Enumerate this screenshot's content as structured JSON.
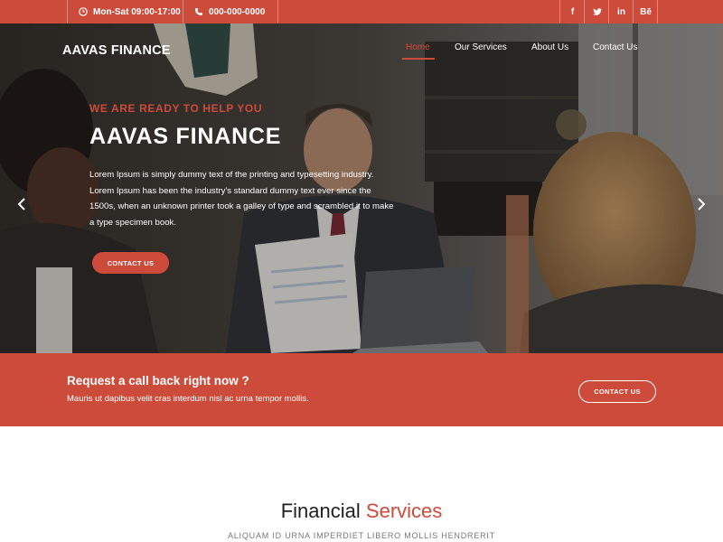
{
  "colors": {
    "accent": "#cd4b3a",
    "text_dark": "#1e1e1e",
    "muted": "#777777"
  },
  "topbar": {
    "hours": {
      "icon": "clock-icon",
      "text": "Mon-Sat 09:00-17:00"
    },
    "phone": {
      "icon": "phone-icon",
      "text": "000-000-0000"
    },
    "social": [
      {
        "name": "facebook-icon",
        "glyph": "f"
      },
      {
        "name": "twitter-icon",
        "glyph": "t"
      },
      {
        "name": "linkedin-icon",
        "glyph": "in"
      },
      {
        "name": "behance-icon",
        "glyph": "Bē"
      }
    ]
  },
  "header": {
    "brand": "AAVAS FINANCE",
    "nav": [
      {
        "label": "Home",
        "active": true
      },
      {
        "label": "Our Services",
        "active": false
      },
      {
        "label": "About Us",
        "active": false
      },
      {
        "label": "Contact Us",
        "active": false
      }
    ]
  },
  "hero": {
    "kicker": "WE ARE READY TO HELP YOU",
    "title": "AAVAS FINANCE",
    "description": "Lorem Ipsum is simply dummy text of the printing and typesetting industry. Lorem Ipsum has been the industry's standard dummy text ever since the 1500s, when an unknown printer took a galley of type and scrambled it to make a type specimen book.",
    "button": "CONTACT US",
    "prev_icon": "chevron-left-icon",
    "next_icon": "chevron-right-icon"
  },
  "callback": {
    "title": "Request a call back right now ?",
    "subtitle": "Mauris ut dapibus velit cras interdum nisl ac urna tempor mollis.",
    "button": "CONTACT US"
  },
  "services": {
    "title_main": "Financial",
    "title_accent": "Services",
    "subtitle": "ALIQUAM ID URNA IMPERDIET LIBERO MOLLIS HENDRERIT"
  }
}
